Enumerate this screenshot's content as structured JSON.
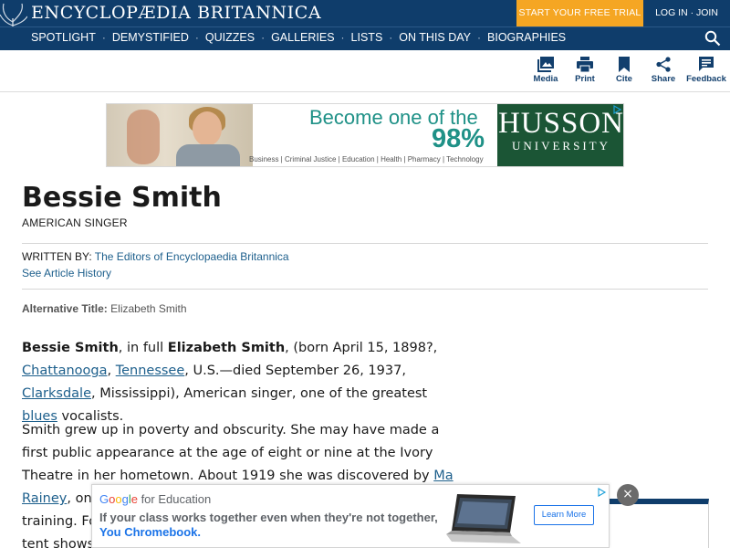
{
  "header": {
    "brand": "ENCYCLOPÆDIA BRITANNICA",
    "trial_button": "START YOUR FREE TRIAL",
    "login": "LOG IN · JOIN",
    "nav": [
      "SPOTLIGHT",
      "DEMYSTIFIED",
      "QUIZZES",
      "GALLERIES",
      "LISTS",
      "ON THIS DAY",
      "BIOGRAPHIES"
    ],
    "nav_separator": "·",
    "search_icon": "search-icon"
  },
  "toolbar": {
    "media": "Media",
    "print": "Print",
    "cite": "Cite",
    "share": "Share",
    "feedback": "Feedback"
  },
  "top_ad": {
    "headline": "Become one of the",
    "percent": "98%",
    "fields": "Business | Criminal Justice | Education | Health | Pharmacy | Technology",
    "logo_line1": "HUSSON",
    "logo_line2": "UNIVERSITY"
  },
  "article": {
    "title": "Bessie Smith",
    "subtitle": "AMERICAN SINGER",
    "written_by_label": "WRITTEN BY:",
    "author": "The Editors of Encyclopaedia Britannica",
    "history_link": "See Article History",
    "alt_title_label": "Alternative Title:",
    "alt_title_value": "Elizabeth Smith",
    "p1": {
      "name": "Bessie Smith",
      "t1": ", in full ",
      "full_name": "Elizabeth Smith",
      "t2": ", (born April 15, 1898?, ",
      "link1": "Chattanooga",
      "t3": ", ",
      "link2": "Tennessee",
      "t4": ", U.S.—died September 26, 1937, ",
      "link3": "Clarksdale",
      "t5": ", Mississippi), American singer, one of the greatest ",
      "link4": "blues",
      "t6": " vocalists."
    },
    "p2": {
      "t1": "Smith grew up in poverty and obscurity. She may have made a first public appearance at the age of eight or nine at the Ivory Theatre in her hometown. About 1919 she was discovered by ",
      "link1": "Ma Rainey",
      "t2": ", one of the first of",
      "t3": "training. Fo",
      "t4": "tent shows"
    }
  },
  "bottom_ad": {
    "brand_google": "Google",
    "brand_sub": " for Education",
    "line1": "If your class works together even when they're not together,",
    "line2": "You Chromebook.",
    "button": "Learn More",
    "close": "×"
  },
  "colors": {
    "header_bg": "#0f3d6b",
    "trial_bg": "#f5a623",
    "link": "#1d5f8c",
    "ad_teal": "#1f9187",
    "ad_logo_bg": "#1b5535",
    "google_blue": "#1a73e8"
  }
}
